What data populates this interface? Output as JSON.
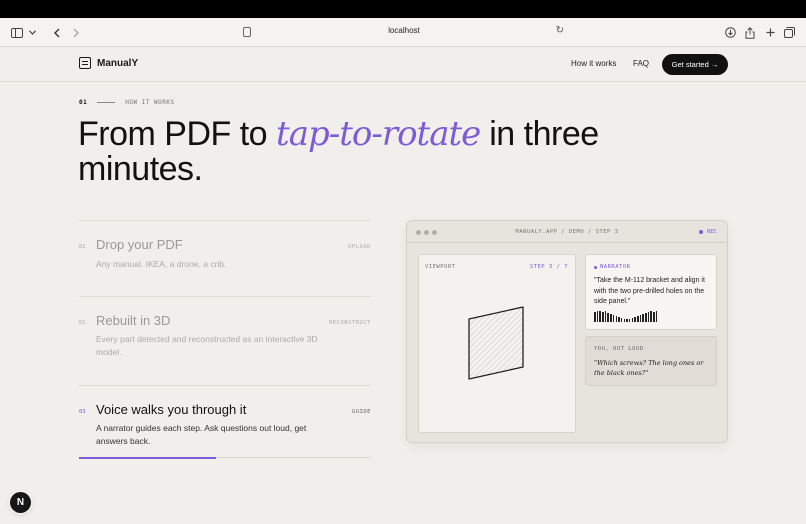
{
  "browser": {
    "url": "localhost",
    "icons": [
      "sidebar-icon",
      "chevron-down-icon",
      "back-icon",
      "forward-icon",
      "page-icon",
      "reload-icon",
      "download-icon",
      "share-icon",
      "new-tab-icon",
      "tabs-icon"
    ]
  },
  "header": {
    "brand": "ManualY",
    "nav": [
      "How it works",
      "FAQ"
    ],
    "cta": "Get started →"
  },
  "hero": {
    "eyebrow_num": "01",
    "eyebrow_label": "HOW IT WORKS",
    "title_before": "From PDF to ",
    "title_accent": "tap-to-rotate",
    "title_after": " in three minutes.",
    "accent_color": "#7e5bd6"
  },
  "steps": [
    {
      "num": "01",
      "title": "Drop your PDF",
      "tag": "UPLOAD",
      "desc": "Any manual. IKEA, a drone, a crib.",
      "active": false
    },
    {
      "num": "02",
      "title": "Rebuilt in 3D",
      "tag": "RECONSTRUCT",
      "desc": "Every part detected and reconstructed as an interactive 3D model.",
      "active": false
    },
    {
      "num": "03",
      "title": "Voice walks you through it",
      "tag": "GUIDE",
      "desc": "A narrator guides each step. Ask questions out loud, get answers back.",
      "active": true
    }
  ],
  "progress": 0.47,
  "demo": {
    "path": "MANUALY.APP / DEMO / STEP 3",
    "rec": "REC",
    "viewport_label": "VIEWPORT",
    "viewport_step": "STEP 3 / 7",
    "narrator_label": "NARRATOR",
    "narrator_quote": "\"Take the M-112 bracket and align it with the two pre-drilled holes on the side panel.\"",
    "ask_label": "YOU, OUT LOUD",
    "ask_quote": "\"Which screws? The long ones or the black ones?\""
  },
  "next_badge": "N"
}
